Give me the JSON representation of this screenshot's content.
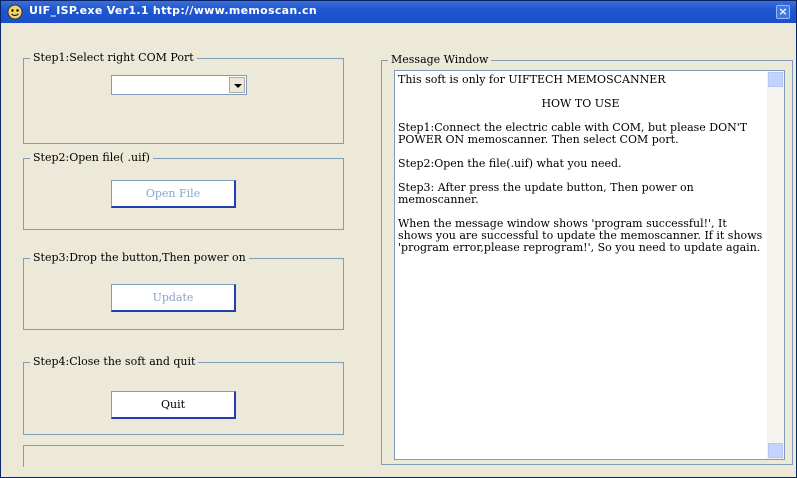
{
  "window": {
    "title": "UIF_ISP.exe  Ver1.1  http://www.memoscan.cn",
    "close_glyph": "×",
    "icon": "app-icon"
  },
  "step1": {
    "legend": "Step1:Select right COM Port",
    "combo_value": ""
  },
  "step2": {
    "legend": "Step2:Open file( .uif)",
    "button": "Open File"
  },
  "step3": {
    "legend": "Step3:Drop the button,Then power on",
    "button": "Update"
  },
  "step4": {
    "legend": "Step4:Close the soft and quit",
    "button": "Quit"
  },
  "message_window": {
    "legend": "Message Window",
    "lines": [
      "This soft is only for UIFTECH MEMOSCANNER",
      "HOW TO USE",
      "Step1:Connect the electric cable with COM, but please DON'T POWER ON memoscanner. Then select COM port.",
      "Step2:Open the file(.uif) what you need.",
      "Step3: After press the update button, Then power on memoscanner.",
      "When the message window shows 'program successful!', It shows you are successful to update the memoscanner. If it shows 'program error,please reprogram!', So you need to update again."
    ]
  },
  "colors": {
    "title_bar": "#2056d0",
    "face": "#ece9d8",
    "border": "#7f9db9",
    "disabled_text": "#8aa4c8"
  }
}
